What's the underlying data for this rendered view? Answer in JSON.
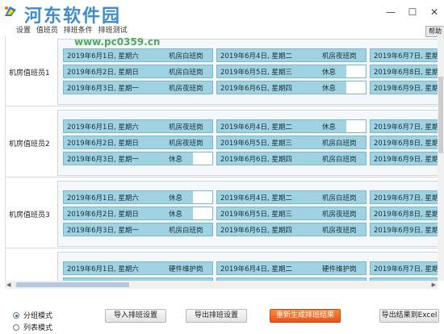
{
  "watermark": {
    "title": "河东软件园",
    "url": "www.pc0359.cn"
  },
  "window": {
    "minimize": "—",
    "maximize": "☐",
    "close": "✕"
  },
  "toolbar": {
    "items": [
      "设置",
      "值班员",
      "排班条件",
      "排班测试"
    ],
    "help": "帮助"
  },
  "groups": [
    {
      "member": "机房值班员1",
      "rows": [
        [
          {
            "date": "2019年6月1日, 星期六",
            "shift": "机房白班岗"
          },
          {
            "date": "2019年6月4日, 星期二",
            "shift": "机房夜班岗"
          },
          {
            "date": "2019年6月7日, 星期五",
            "shift": ""
          }
        ],
        [
          {
            "date": "2019年6月2日, 星期日",
            "shift": "机房白班岗"
          },
          {
            "date": "2019年6月5日, 星期三",
            "shift": "休息"
          },
          {
            "date": "2019年6月8日, 星期六",
            "shift": ""
          }
        ],
        [
          {
            "date": "2019年6月3日, 星期一",
            "shift": "机房夜班岗"
          },
          {
            "date": "2019年6月6日, 星期四",
            "shift": "休息"
          },
          {
            "date": "2019年6月9日, 星期日",
            "shift": ""
          }
        ]
      ]
    },
    {
      "member": "机房值班员2",
      "rows": [
        [
          {
            "date": "2019年6月1日, 星期六",
            "shift": "机房夜班岗"
          },
          {
            "date": "2019年6月4日, 星期二",
            "shift": "休息"
          },
          {
            "date": "2019年6月7日, 星期五",
            "shift": ""
          }
        ],
        [
          {
            "date": "2019年6月2日, 星期日",
            "shift": "机房夜班岗"
          },
          {
            "date": "2019年6月5日, 星期三",
            "shift": "机房白班岗"
          },
          {
            "date": "2019年6月8日, 星期六",
            "shift": ""
          }
        ],
        [
          {
            "date": "2019年6月3日, 星期一",
            "shift": "休息"
          },
          {
            "date": "2019年6月6日, 星期四",
            "shift": "机房白班岗"
          },
          {
            "date": "2019年6月9日, 星期日",
            "shift": ""
          }
        ]
      ]
    },
    {
      "member": "机房值班员3",
      "rows": [
        [
          {
            "date": "2019年6月1日, 星期六",
            "shift": "休息"
          },
          {
            "date": "2019年6月4日, 星期二",
            "shift": "机房白班岗"
          },
          {
            "date": "2019年6月7日, 星期五",
            "shift": ""
          }
        ],
        [
          {
            "date": "2019年6月2日, 星期日",
            "shift": "休息"
          },
          {
            "date": "2019年6月5日, 星期三",
            "shift": "机房夜班岗"
          },
          {
            "date": "2019年6月8日, 星期六",
            "shift": ""
          }
        ],
        [
          {
            "date": "2019年6月3日, 星期一",
            "shift": "机房白班岗"
          },
          {
            "date": "2019年6月6日, 星期四",
            "shift": "机房夜班岗"
          },
          {
            "date": "2019年6月9日, 星期日",
            "shift": ""
          }
        ]
      ]
    },
    {
      "member": "",
      "rows": [
        [
          {
            "date": "2019年6月1日, 星期六",
            "shift": "硬件维护岗"
          },
          {
            "date": "2019年6月4日, 星期二",
            "shift": "硬件维护岗"
          },
          {
            "date": "2019年6月7日, 星期五",
            "shift": ""
          }
        ],
        [
          {
            "date": "2019年6月2日, 星期日",
            "shift": "硬件维护岗"
          },
          {
            "date": "2019年6月5日, 星期三",
            "shift": "硬件维护岗"
          },
          {
            "date": "2019年6月8日, 星期六",
            "shift": ""
          }
        ]
      ]
    }
  ],
  "view_mode": {
    "group": "分组模式",
    "list": "列表模式",
    "selected": "group"
  },
  "buttons": {
    "import": "导入排班设置",
    "export_settings": "导出排班设置",
    "regenerate": "重新生成排班结果",
    "export_excel": "导出结果到Excel"
  },
  "colors": {
    "cell": "#9fd3e2",
    "accent": "#e8521a",
    "watermark_blue": "#2a80c8",
    "watermark_green": "#3aa24a"
  }
}
